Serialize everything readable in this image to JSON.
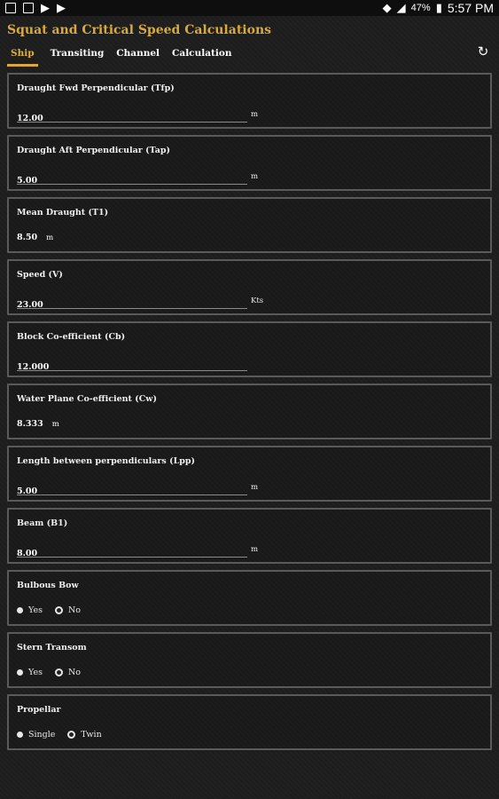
{
  "status": {
    "battery": "47%",
    "time": "5:57 PM"
  },
  "app": {
    "title": "Squat and Critical Speed Calculations"
  },
  "tabs": [
    {
      "label": "Ship"
    },
    {
      "label": "Transiting"
    },
    {
      "label": "Channel"
    },
    {
      "label": "Calculation"
    }
  ],
  "fields": {
    "draught_fwd": {
      "label": "Draught Fwd Perpendicular (Tfp)",
      "value": "12.00",
      "unit": "m"
    },
    "draught_aft": {
      "label": "Draught Aft Perpendicular (Tap)",
      "value": "5.00",
      "unit": "m"
    },
    "mean_draught": {
      "label": "Mean Draught (T1)",
      "value": "8.50",
      "unit": "m"
    },
    "speed": {
      "label": "Speed (V)",
      "value": "23.00",
      "unit": "Kts"
    },
    "block_coeff": {
      "label": "Block Co-efficient (Cb)",
      "value": "12.000"
    },
    "water_plane": {
      "label": "Water Plane Co-efficient (Cw)",
      "value": "8.333",
      "unit": "m"
    },
    "lpp": {
      "label": "Length between perpendiculars (Lpp)",
      "value": "5.00",
      "unit": "m"
    },
    "beam": {
      "label": "Beam (B1)",
      "value": "8.00",
      "unit": "m"
    }
  },
  "options": {
    "bulbous_bow": {
      "label": "Bulbous Bow",
      "a": "Yes",
      "b": "No"
    },
    "stern_transom": {
      "label": "Stern Transom",
      "a": "Yes",
      "b": "No"
    },
    "propellar": {
      "label": "Propellar",
      "a": "Single",
      "b": "Twin"
    }
  }
}
